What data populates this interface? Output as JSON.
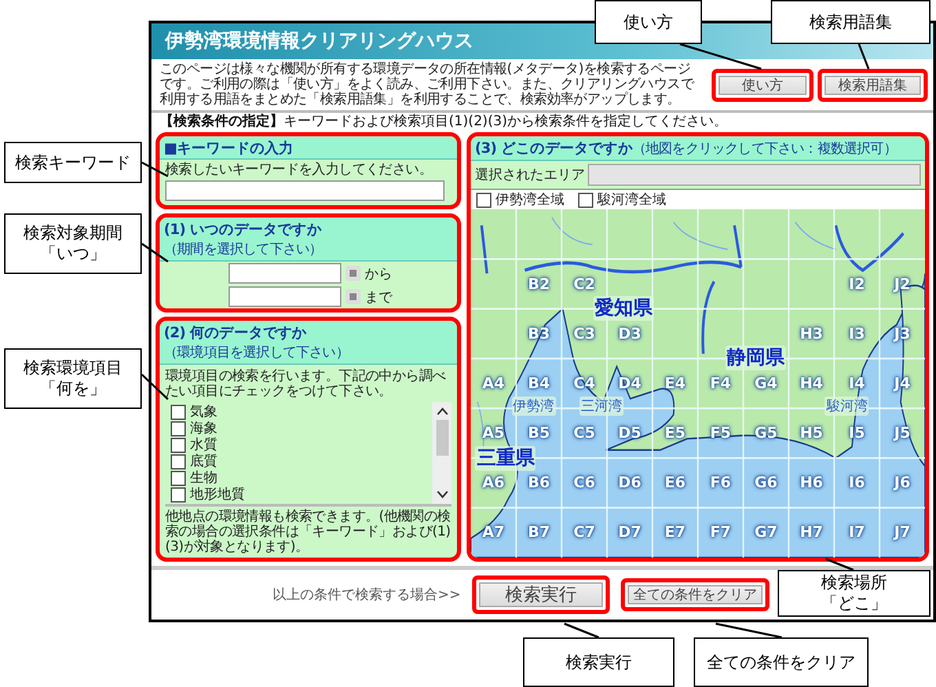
{
  "header": {
    "title": "伊勢湾環境情報クリアリングハウス"
  },
  "intro": "このページは様々な機関が所有する環境データの所在情報(メタデータ)を検索するページです。ご利用の際は「使い方」をよく読み、ご利用下さい。また、クリアリングハウスで利用する用語をまとめた「検索用語集」を利用することで、検索効率がアップします。",
  "top_buttons": [
    {
      "label": "使い方",
      "highlighted": true
    },
    {
      "label": "検索用語集",
      "highlighted": true
    }
  ],
  "instruction": "**【検索条件の指定】**キーワードおよび検索項目(1)(2)(3)から検索条件を指定してください。",
  "keyword_panel": {
    "title": "■キーワードの入力",
    "hint": "検索したいキーワードを入力してください。",
    "highlighted": true
  },
  "period_panel": {
    "title": "(1) いつのデータですか",
    "note": "（期間を選択して下さい）",
    "highlighted": true,
    "fields": [
      {
        "suffix": "から"
      },
      {
        "suffix": "まで"
      }
    ]
  },
  "item_panel": {
    "title": "(2) 何のデータですか",
    "note": "（環境項目を選択して下さい）",
    "highlighted": true,
    "description": "環境項目の検索を行います。下記の中から調べたい項目にチェックをつけて下さい。",
    "items": [
      {
        "label": "気象",
        "checked": false
      },
      {
        "label": "海象",
        "checked": false
      },
      {
        "label": "水質",
        "checked": false
      },
      {
        "label": "底質",
        "checked": false
      },
      {
        "label": "生物",
        "checked": false
      },
      {
        "label": "地形地質",
        "checked": false
      }
    ],
    "footnote": "他地点の環境情報も検索できます。(他機関の検索の場合の選択条件は「キーワード」および(1)(3)が対象となります)。"
  },
  "area_panel": {
    "title": "(3) どこのデータですか",
    "note": "（地図をクリックして下さい：複数選択可）",
    "highlighted": true,
    "selected_label": "選択されたエリア",
    "options": [
      {
        "label": "伊勢湾全域",
        "checked": false
      },
      {
        "label": "駿河湾全域",
        "checked": false
      }
    ],
    "map": {
      "place_labels": [
        {
          "text": "愛知県",
          "kind": "prefecture"
        },
        {
          "text": "静岡県",
          "kind": "prefecture"
        },
        {
          "text": "三重県",
          "kind": "prefecture"
        },
        {
          "text": "伊勢湾",
          "kind": "bay"
        },
        {
          "text": "三河湾",
          "kind": "bay"
        },
        {
          "text": "駿河湾",
          "kind": "bay"
        }
      ],
      "grid": [
        [
          {
            "kind": "blank"
          },
          {
            "kind": "blank"
          },
          {
            "kind": "blank"
          },
          {
            "kind": "blank"
          },
          {
            "kind": "blank"
          },
          {
            "kind": "blank"
          },
          {
            "kind": "blank"
          },
          {
            "kind": "blank"
          },
          {
            "kind": "blank"
          },
          {
            "kind": "blank"
          }
        ],
        [
          {
            "kind": "blank"
          },
          {
            "kind": "labeled",
            "label": "B2"
          },
          {
            "kind": "labeled",
            "label": "C2"
          },
          {
            "kind": "blank"
          },
          {
            "kind": "blank"
          },
          {
            "kind": "blank"
          },
          {
            "kind": "blank"
          },
          {
            "kind": "blank"
          },
          {
            "kind": "labeled",
            "label": "I2"
          },
          {
            "kind": "labeled",
            "label": "J2"
          }
        ],
        [
          {
            "kind": "blank"
          },
          {
            "kind": "labeled",
            "label": "B3"
          },
          {
            "kind": "labeled",
            "label": "C3"
          },
          {
            "kind": "labeled",
            "label": "D3"
          },
          {
            "kind": "blank"
          },
          {
            "kind": "blank"
          },
          {
            "kind": "blank"
          },
          {
            "kind": "labeled",
            "label": "H3"
          },
          {
            "kind": "labeled",
            "label": "I3"
          },
          {
            "kind": "labeled",
            "label": "J3"
          }
        ],
        [
          {
            "kind": "labeled",
            "label": "A4"
          },
          {
            "kind": "labeled",
            "label": "B4"
          },
          {
            "kind": "labeled",
            "label": "C4"
          },
          {
            "kind": "labeled",
            "label": "D4"
          },
          {
            "kind": "labeled",
            "label": "E4"
          },
          {
            "kind": "labeled",
            "label": "F4"
          },
          {
            "kind": "labeled",
            "label": "G4"
          },
          {
            "kind": "labeled",
            "label": "H4"
          },
          {
            "kind": "labeled",
            "label": "I4"
          },
          {
            "kind": "labeled",
            "label": "J4"
          }
        ],
        [
          {
            "kind": "labeled",
            "label": "A5"
          },
          {
            "kind": "labeled",
            "label": "B5"
          },
          {
            "kind": "labeled",
            "label": "C5"
          },
          {
            "kind": "labeled",
            "label": "D5"
          },
          {
            "kind": "labeled",
            "label": "E5"
          },
          {
            "kind": "labeled",
            "label": "F5"
          },
          {
            "kind": "labeled",
            "label": "G5"
          },
          {
            "kind": "labeled",
            "label": "H5"
          },
          {
            "kind": "labeled",
            "label": "I5"
          },
          {
            "kind": "labeled",
            "label": "J5"
          }
        ],
        [
          {
            "kind": "labeled",
            "label": "A6"
          },
          {
            "kind": "labeled",
            "label": "B6"
          },
          {
            "kind": "labeled",
            "label": "C6"
          },
          {
            "kind": "labeled",
            "label": "D6"
          },
          {
            "kind": "labeled",
            "label": "E6"
          },
          {
            "kind": "labeled",
            "label": "F6"
          },
          {
            "kind": "labeled",
            "label": "G6"
          },
          {
            "kind": "labeled",
            "label": "H6"
          },
          {
            "kind": "labeled",
            "label": "I6"
          },
          {
            "kind": "labeled",
            "label": "J6"
          }
        ],
        [
          {
            "kind": "labeled",
            "label": "A7"
          },
          {
            "kind": "labeled",
            "label": "B7"
          },
          {
            "kind": "labeled",
            "label": "C7"
          },
          {
            "kind": "labeled",
            "label": "D7"
          },
          {
            "kind": "labeled",
            "label": "E7"
          },
          {
            "kind": "labeled",
            "label": "F7"
          },
          {
            "kind": "labeled",
            "label": "G7"
          },
          {
            "kind": "labeled",
            "label": "H7"
          },
          {
            "kind": "labeled",
            "label": "I7"
          },
          {
            "kind": "labeled",
            "label": "J7"
          }
        ]
      ]
    }
  },
  "footer": {
    "prompt": "以上の条件で検索する場合>>",
    "buttons": [
      {
        "label": "検索実行",
        "kind": "primary",
        "highlighted": true
      },
      {
        "label": "全ての条件をクリア",
        "kind": "secondary",
        "highlighted": true
      }
    ]
  },
  "callouts": [
    {
      "lines": [
        "使い方"
      ]
    },
    {
      "lines": [
        "検索用語集"
      ]
    },
    {
      "lines": [
        "検索キーワード"
      ]
    },
    {
      "lines": [
        "検索対象期間",
        "「いつ」"
      ]
    },
    {
      "lines": [
        "検索環境項目",
        "「何を」"
      ]
    },
    {
      "lines": [
        "検索場所",
        "「どこ」"
      ]
    },
    {
      "lines": [
        "検索実行"
      ]
    },
    {
      "lines": [
        "全ての条件をクリア"
      ]
    }
  ]
}
